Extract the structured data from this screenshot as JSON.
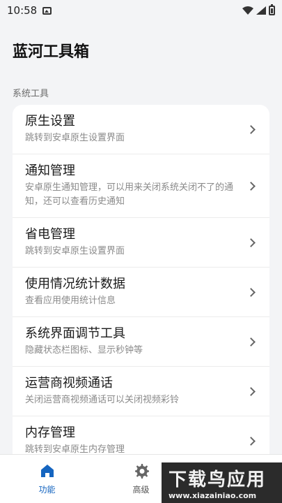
{
  "status_bar": {
    "time": "10:58"
  },
  "app": {
    "title": "蓝河工具箱"
  },
  "section": {
    "label": "系统工具"
  },
  "items": [
    {
      "title": "原生设置",
      "subtitle": "跳转到安卓原生设置界面"
    },
    {
      "title": "通知管理",
      "subtitle": "安卓原生通知管理，可以用来关闭系统关闭不了的通知，还可以查看历史通知"
    },
    {
      "title": "省电管理",
      "subtitle": "跳转到安卓原生设置界面"
    },
    {
      "title": "使用情况统计数据",
      "subtitle": "查看应用使用统计信息"
    },
    {
      "title": "系统界面调节工具",
      "subtitle": "隐藏状态栏图标、显示秒钟等"
    },
    {
      "title": "运营商视频通话",
      "subtitle": "关闭运营商视频通话可以关闭视频彩铃"
    },
    {
      "title": "内存管理",
      "subtitle": "跳转到安卓原生内存管理"
    }
  ],
  "nav": {
    "tabs": [
      {
        "label": "功能",
        "icon": "home-icon",
        "active": true
      },
      {
        "label": "高级",
        "icon": "gear-icon",
        "active": false
      }
    ]
  },
  "watermark": {
    "text": "下载鸟应用",
    "url": "www.xiazainiao.com"
  },
  "colors": {
    "accent": "#1565c0",
    "background": "#f3f4f6",
    "card": "#ffffff"
  }
}
